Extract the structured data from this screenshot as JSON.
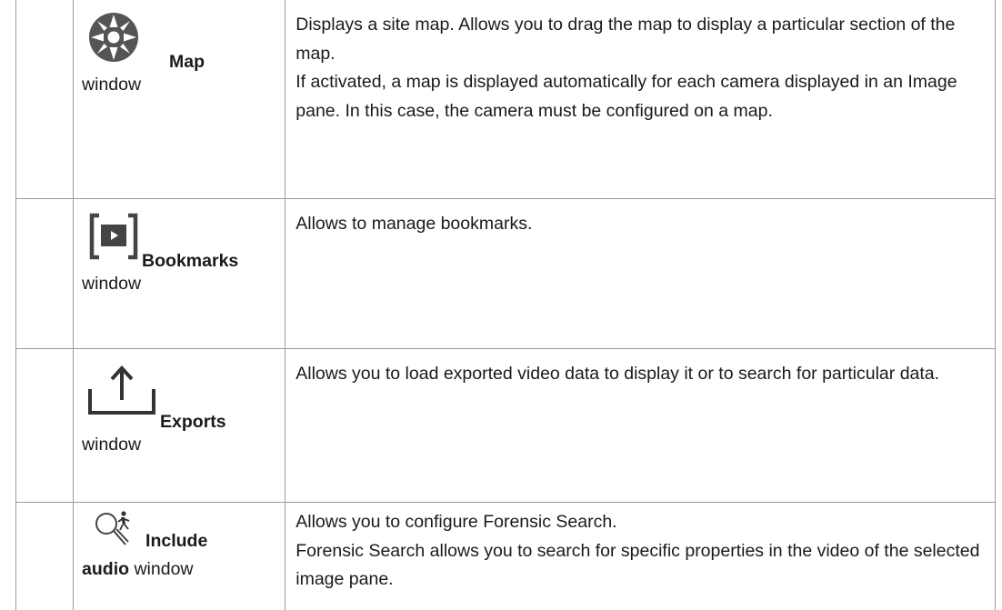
{
  "rows": [
    {
      "icon": "map-compass-icon",
      "window_name": "Map",
      "window_suffix": "window",
      "description": [
        "Displays a site map. Allows you to drag the map to display a particular section of the map.",
        "If activated, a map is displayed automatically for each camera displayed in an Image pane. In this case, the camera must be configured on a map."
      ]
    },
    {
      "icon": "bookmarks-icon",
      "window_name": "Bookmarks",
      "window_suffix": "window",
      "description": [
        "Allows to manage bookmarks."
      ]
    },
    {
      "icon": "export-upload-icon",
      "window_name": "Exports",
      "window_suffix": "window",
      "description": [
        "Allows you to load exported video data to display it or to search for particular data."
      ]
    },
    {
      "icon": "forensic-search-icon",
      "window_name_line1": "Include",
      "window_name_line2": "audio",
      "window_suffix": "window",
      "description": [
        "Allows you to configure Forensic Search.",
        "Forensic Search allows you to search for specific properties in the video of the selected image pane."
      ]
    }
  ]
}
